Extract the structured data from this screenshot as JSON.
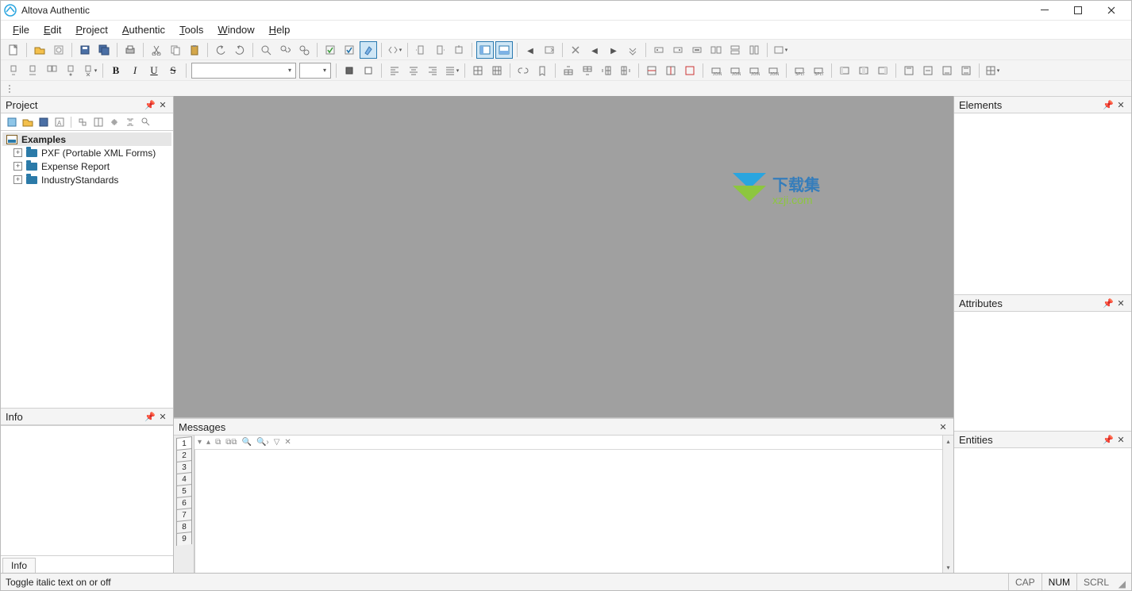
{
  "app": {
    "title": "Altova Authentic"
  },
  "menubar": {
    "file": "File",
    "edit": "Edit",
    "project": "Project",
    "authentic": "Authentic",
    "tools": "Tools",
    "window": "Window",
    "help": "Help"
  },
  "panels": {
    "project": {
      "title": "Project"
    },
    "info": {
      "title": "Info",
      "tab": "Info"
    },
    "messages": {
      "title": "Messages"
    },
    "elements": {
      "title": "Elements"
    },
    "attributes": {
      "title": "Attributes"
    },
    "entities": {
      "title": "Entities"
    }
  },
  "project_tree": {
    "root": "Examples",
    "items": {
      "0": "PXF (Portable XML Forms)",
      "1": "Expense Report",
      "2": "IndustryStandards"
    }
  },
  "statusbar": {
    "hint": "Toggle italic text on or off",
    "cap": "CAP",
    "num": "NUM",
    "scrl": "SCRL"
  },
  "watermark": {
    "line1": "下载集",
    "line2": "xzji.com"
  },
  "messages_tabs": {
    "t1": "1",
    "t2": "2",
    "t3": "3",
    "t4": "4",
    "t5": "5",
    "t6": "6",
    "t7": "7",
    "t8": "8",
    "t9": "9"
  }
}
